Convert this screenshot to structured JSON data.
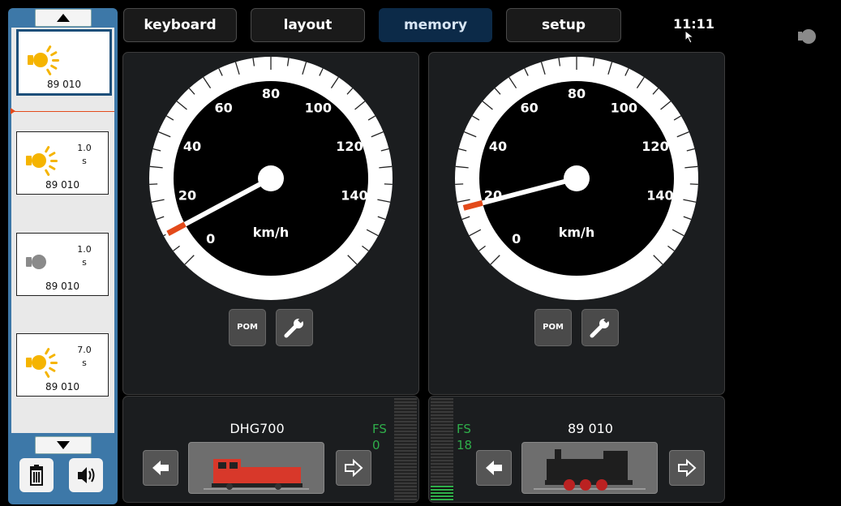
{
  "tabs": [
    {
      "label": "keyboard",
      "active": false
    },
    {
      "label": "layout",
      "active": false
    },
    {
      "label": "memory",
      "active": true
    },
    {
      "label": "setup",
      "active": false
    }
  ],
  "clock": "11:11",
  "status_icon": "light-off-icon",
  "sequence": {
    "steps": [
      {
        "icon": "light-on-icon",
        "duration_value": "",
        "duration_unit": "",
        "loco": "89 010",
        "selected": true
      },
      {
        "icon": "light-on-icon",
        "duration_value": "1.0",
        "duration_unit": "s",
        "loco": "89 010",
        "selected": false
      },
      {
        "icon": "light-off-icon",
        "duration_value": "1.0",
        "duration_unit": "s",
        "loco": "89 010",
        "selected": false
      },
      {
        "icon": "light-on-icon",
        "duration_value": "7.0",
        "duration_unit": "s",
        "loco": "89 010",
        "selected": false
      }
    ],
    "scroll_up_icon": "up-arrow-icon",
    "scroll_down_icon": "down-arrow-icon",
    "delete_icon": "trash-icon",
    "sound_icon": "speaker-icon"
  },
  "speedometers": [
    {
      "unit": "km/h",
      "ticks": [
        "0",
        "20",
        "40",
        "60",
        "80",
        "100",
        "120",
        "140"
      ],
      "speed": 0,
      "needle_kmh": 10,
      "pom_label": "POM",
      "wrench_icon": "wrench-icon"
    },
    {
      "unit": "km/h",
      "ticks": [
        "0",
        "20",
        "40",
        "60",
        "80",
        "100",
        "120",
        "140"
      ],
      "speed": 18,
      "needle_kmh": 18,
      "pom_label": "POM",
      "wrench_icon": "wrench-icon"
    }
  ],
  "locos": [
    {
      "name": "DHG700",
      "fs_label": "FS",
      "fs_value": "0",
      "level": 0,
      "prev_icon": "arrow-left-icon",
      "next_icon": "arrow-right-outline-icon"
    },
    {
      "name": "89 010",
      "fs_label": "FS",
      "fs_value": "18",
      "level": 0.14,
      "prev_icon": "arrow-left-icon",
      "next_icon": "arrow-right-outline-icon"
    }
  ],
  "colors": {
    "accent": "#0c2a48",
    "sidebar": "#3d78a8",
    "needle_tip": "#e34a1a",
    "fs_green": "#2fae4a",
    "light_on": "#f5b400"
  }
}
